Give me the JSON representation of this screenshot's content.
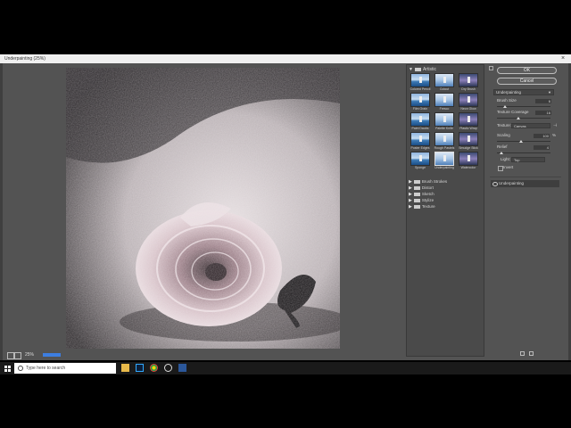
{
  "window": {
    "title": "Underpainting (25%)",
    "close_glyph": "×"
  },
  "status": {
    "zoom": "25%"
  },
  "gallery": {
    "open_category": "Artistic",
    "thumbnails": [
      {
        "label": "Colored Pencil"
      },
      {
        "label": "Cutout"
      },
      {
        "label": "Dry Brush"
      },
      {
        "label": "Film Grain"
      },
      {
        "label": "Fresco"
      },
      {
        "label": "Neon Glow"
      },
      {
        "label": "Paint Daubs"
      },
      {
        "label": "Palette Knife"
      },
      {
        "label": "Plastic Wrap"
      },
      {
        "label": "Poster Edges"
      },
      {
        "label": "Rough Pastels"
      },
      {
        "label": "Smudge Stick"
      },
      {
        "label": "Sponge"
      },
      {
        "label": "Underpainting"
      },
      {
        "label": "Watercolor"
      }
    ],
    "selected": "Underpainting",
    "collapsed_categories": [
      "Brush Strokes",
      "Distort",
      "Sketch",
      "Stylize",
      "Texture"
    ]
  },
  "panel": {
    "ok_label": "OK",
    "cancel_label": "Cancel",
    "filter_select": "Underpainting",
    "brush_size": {
      "label": "Brush Size",
      "value": "6",
      "fraction": 0.15
    },
    "texture_coverage": {
      "label": "Texture Coverage",
      "value": "16",
      "fraction": 0.4
    },
    "texture": {
      "label": "Texture:",
      "value": "Canvas"
    },
    "scaling": {
      "label": "Scaling",
      "value": "100",
      "unit": "%",
      "fraction": 0.45
    },
    "relief": {
      "label": "Relief",
      "value": "4",
      "fraction": 0.08
    },
    "light": {
      "label": "Light:",
      "value": "Top"
    },
    "invert_label": "Invert",
    "applied_layer": "Underpainting"
  },
  "taskbar": {
    "search_placeholder": "Type here to search"
  },
  "colors": {
    "accent": "#3d7ee0",
    "panel_bg": "#535353",
    "gallery_bg": "#4a4a4a"
  }
}
